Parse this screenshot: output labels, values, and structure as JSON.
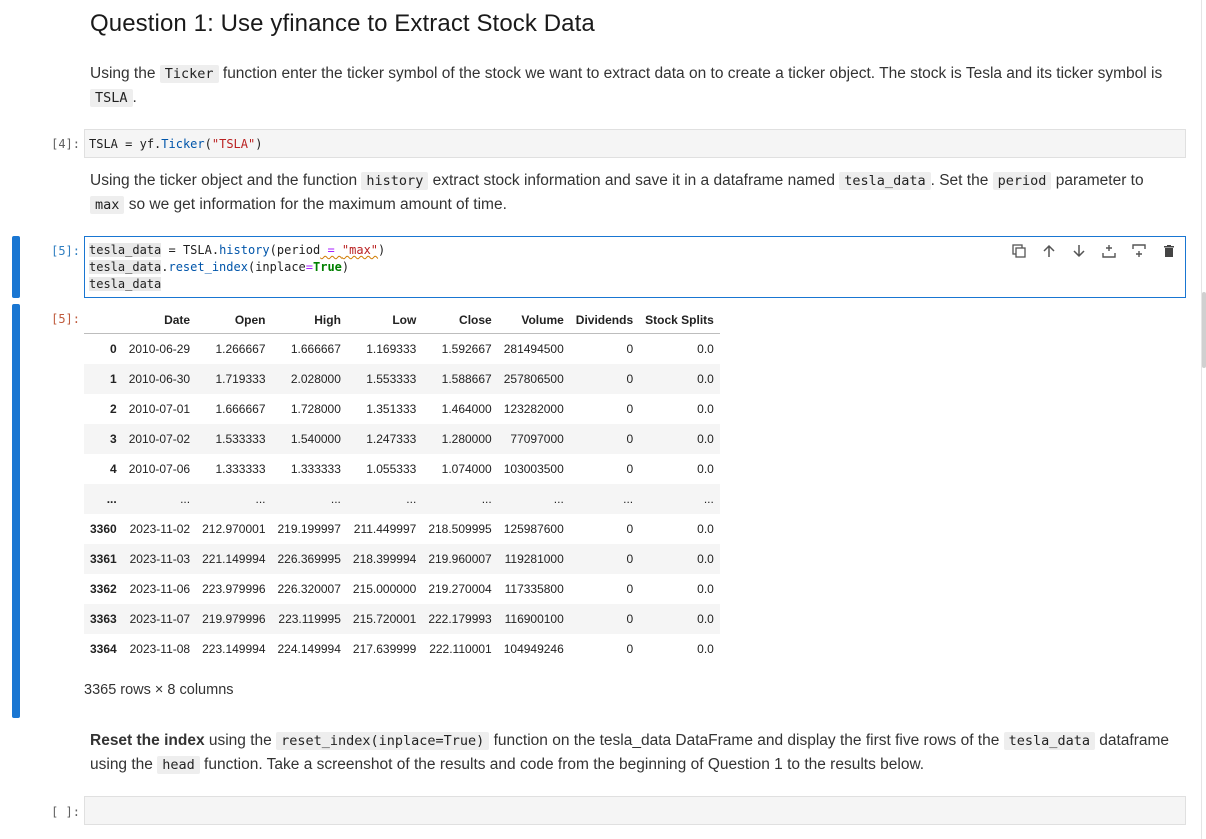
{
  "heading": "Question 1: Use yfinance to Extract Stock Data",
  "md1": {
    "t1": "Using the ",
    "c1": "Ticker",
    "t2": " function enter the ticker symbol of the stock we want to extract data on to create a ticker object. The stock is Tesla and its ticker symbol is ",
    "c2": "TSLA",
    "t3": "."
  },
  "cell4": {
    "prompt": "[4]:",
    "var": "TSLA",
    "eq": " = ",
    "obj": "yf.",
    "fn": "Ticker",
    "open": "(",
    "str": "\"TSLA\"",
    "close": ")"
  },
  "md2": {
    "t1": "Using the ticker object and the function ",
    "c1": "history",
    "t2": " extract stock information and save it in a dataframe named ",
    "c2": "tesla_data",
    "t3": ". Set the ",
    "c3": "period",
    "t4": " parameter to ",
    "c4": "max",
    "t5": " so we get information for the maximum amount of time."
  },
  "cell5": {
    "prompt": "[5]:",
    "l1_var": "tesla_data",
    "l1_eq": " = ",
    "l1_obj": "TSLA.",
    "l1_fn": "history",
    "l1_open": "(period",
    "l1_op": " = ",
    "l1_str": "\"max\"",
    "l1_close": ")",
    "l2_var": "tesla_data",
    "l2_dot": ".",
    "l2_fn": "reset_index",
    "l2_open": "(inplace",
    "l2_op": "=",
    "l2_kw": "True",
    "l2_close": ")",
    "l3_var": "tesla_data"
  },
  "output5": {
    "prompt": "[5]:",
    "columns": [
      "",
      "Date",
      "Open",
      "High",
      "Low",
      "Close",
      "Volume",
      "Dividends",
      "Stock Splits"
    ],
    "rows": [
      [
        "0",
        "2010-06-29",
        "1.266667",
        "1.666667",
        "1.169333",
        "1.592667",
        "281494500",
        "0",
        "0.0"
      ],
      [
        "1",
        "2010-06-30",
        "1.719333",
        "2.028000",
        "1.553333",
        "1.588667",
        "257806500",
        "0",
        "0.0"
      ],
      [
        "2",
        "2010-07-01",
        "1.666667",
        "1.728000",
        "1.351333",
        "1.464000",
        "123282000",
        "0",
        "0.0"
      ],
      [
        "3",
        "2010-07-02",
        "1.533333",
        "1.540000",
        "1.247333",
        "1.280000",
        "77097000",
        "0",
        "0.0"
      ],
      [
        "4",
        "2010-07-06",
        "1.333333",
        "1.333333",
        "1.055333",
        "1.074000",
        "103003500",
        "0",
        "0.0"
      ],
      [
        "...",
        "...",
        "...",
        "...",
        "...",
        "...",
        "...",
        "...",
        "..."
      ],
      [
        "3360",
        "2023-11-02",
        "212.970001",
        "219.199997",
        "211.449997",
        "218.509995",
        "125987600",
        "0",
        "0.0"
      ],
      [
        "3361",
        "2023-11-03",
        "221.149994",
        "226.369995",
        "218.399994",
        "219.960007",
        "119281000",
        "0",
        "0.0"
      ],
      [
        "3362",
        "2023-11-06",
        "223.979996",
        "226.320007",
        "215.000000",
        "219.270004",
        "117335800",
        "0",
        "0.0"
      ],
      [
        "3363",
        "2023-11-07",
        "219.979996",
        "223.119995",
        "215.720001",
        "222.179993",
        "116900100",
        "0",
        "0.0"
      ],
      [
        "3364",
        "2023-11-08",
        "223.149994",
        "224.149994",
        "217.639999",
        "222.110001",
        "104949246",
        "0",
        "0.0"
      ]
    ],
    "shape": "3365 rows × 8 columns"
  },
  "md3": {
    "b1": "Reset the index",
    "t1": " using the ",
    "c1": "reset_index(inplace=True)",
    "t2": " function on the tesla_data DataFrame and display the first five rows of the ",
    "c2": "tesla_data",
    "t3": " dataframe using the ",
    "c3": "head",
    "t4": " function. Take a screenshot of the results and code from the beginning of Question 1 to the results below."
  },
  "cell_empty": {
    "prompt": "[ ]:"
  },
  "toolbar": {
    "icons": [
      "duplicate-icon",
      "move-up-icon",
      "move-down-icon",
      "insert-above-icon",
      "insert-below-icon",
      "delete-icon"
    ]
  }
}
